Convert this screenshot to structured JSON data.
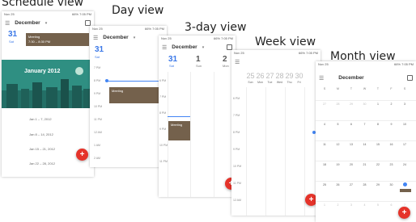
{
  "captions": {
    "schedule": "Schedule view",
    "day": "Day view",
    "three_day": "3-day view",
    "week": "Week view",
    "month": "Month view"
  },
  "status_bar": {
    "carrier": "Nov 25",
    "right": "66% 7:05 PM"
  },
  "schedule_view": {
    "month": "December",
    "date": "31",
    "day": "Sat",
    "event_title": "Meeting",
    "event_time": "7:30 – 8:30 PM",
    "banner": "January 2012",
    "weeks": [
      "Jan 1 – 7, 2012",
      "Jan 8 – 14, 2012",
      "Jan 15 – 21, 2012",
      "Jan 22 – 28, 2012"
    ]
  },
  "day_view": {
    "month": "December",
    "date": "31",
    "day": "Sat",
    "event_title": "Meeting",
    "hours": [
      "7 PM",
      "8 PM",
      "9 PM",
      "10 PM",
      "11 PM",
      "12 AM",
      "1 AM",
      "2 AM"
    ]
  },
  "three_day_view": {
    "month": "December",
    "days": [
      {
        "num": "31",
        "name": "Sat"
      },
      {
        "num": "1",
        "name": "Sun"
      },
      {
        "num": "2",
        "name": "Mon"
      }
    ],
    "event_title": "Meeting",
    "hours": [
      "6 PM",
      "7 PM",
      "8 PM",
      "9 PM",
      "10 PM",
      "11 PM"
    ]
  },
  "week_view": {
    "days": [
      {
        "num": "25",
        "name": "Sun"
      },
      {
        "num": "26",
        "name": "Mon"
      },
      {
        "num": "27",
        "name": "Tue"
      },
      {
        "num": "28",
        "name": "Wed"
      },
      {
        "num": "29",
        "name": "Thu"
      },
      {
        "num": "30",
        "name": "Fri"
      }
    ],
    "hours": [
      "6 PM",
      "7 PM",
      "8 PM",
      "9 PM",
      "10 PM",
      "11 PM",
      "12 AM"
    ]
  },
  "month_view": {
    "month": "December",
    "weekdays": [
      "S",
      "M",
      "T",
      "W",
      "T",
      "F",
      "S"
    ],
    "weeks": [
      [
        "27",
        "28",
        "29",
        "30",
        "1",
        "2",
        "3"
      ],
      [
        "4",
        "5",
        "6",
        "7",
        "8",
        "9",
        "10"
      ],
      [
        "11",
        "12",
        "13",
        "14",
        "15",
        "16",
        "17"
      ],
      [
        "18",
        "19",
        "20",
        "21",
        "22",
        "23",
        "24"
      ],
      [
        "25",
        "26",
        "27",
        "28",
        "29",
        "30",
        "31"
      ],
      [
        "1",
        "2",
        "3",
        "4",
        "5",
        "6",
        "7"
      ]
    ]
  },
  "colors": {
    "accent": "#4285f4",
    "event": "#74614c",
    "fab": "#e5332a",
    "banner": "#2f8f82"
  },
  "icons": [
    "menu-icon",
    "calendar-icon",
    "add-icon",
    "dropdown-caret-icon"
  ]
}
